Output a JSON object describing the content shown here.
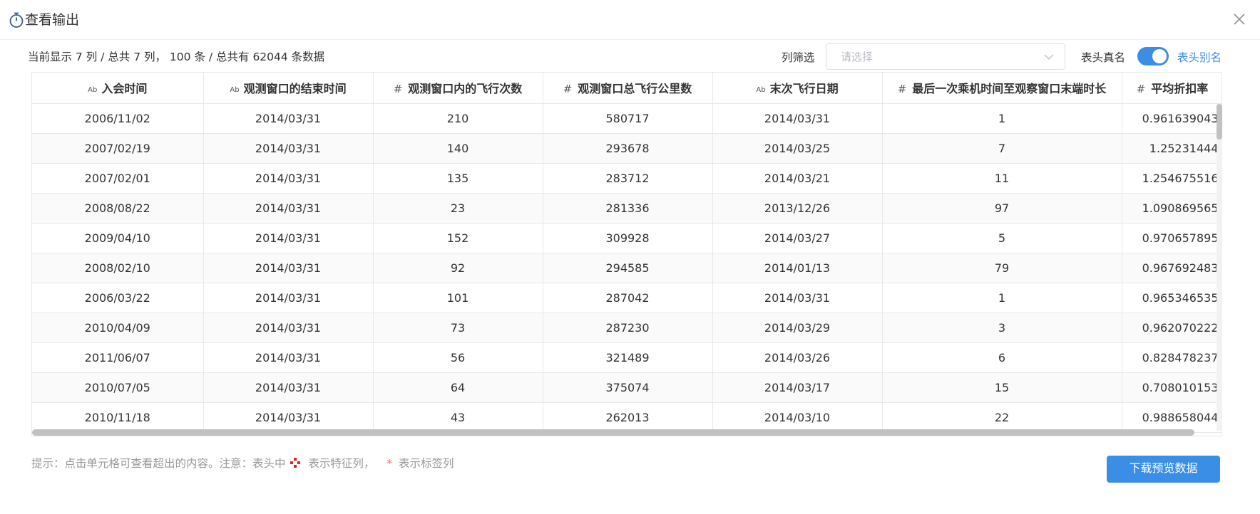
{
  "dialog": {
    "title": "查看输出",
    "icon": "stopwatch-icon",
    "close_icon": "close-icon"
  },
  "toolbar": {
    "info": "当前显示 7 列 / 总共 7 列， 100 条 / 总共有 62044 条数据",
    "filter_label": "列筛选",
    "filter_placeholder": "请选择",
    "realname_label": "表头真名",
    "toggle_on": true,
    "alias_label": "表头别名"
  },
  "table": {
    "columns": [
      {
        "type": "Ab",
        "label": "入会时间"
      },
      {
        "type": "Ab",
        "label": "观测窗口的结束时间"
      },
      {
        "type": "#",
        "label": "观测窗口内的飞行次数"
      },
      {
        "type": "#",
        "label": "观测窗口总飞行公里数"
      },
      {
        "type": "Ab",
        "label": "末次飞行日期"
      },
      {
        "type": "#",
        "label": "最后一次乘机时间至观察窗口末端时长"
      },
      {
        "type": "#",
        "label": "平均折扣率"
      }
    ],
    "rows": [
      [
        "2006/11/02",
        "2014/03/31",
        "210",
        "580717",
        "2014/03/31",
        "1",
        "0.961639043"
      ],
      [
        "2007/02/19",
        "2014/03/31",
        "140",
        "293678",
        "2014/03/25",
        "7",
        "1.25231444"
      ],
      [
        "2007/02/01",
        "2014/03/31",
        "135",
        "283712",
        "2014/03/21",
        "11",
        "1.254675516"
      ],
      [
        "2008/08/22",
        "2014/03/31",
        "23",
        "281336",
        "2013/12/26",
        "97",
        "1.090869565"
      ],
      [
        "2009/04/10",
        "2014/03/31",
        "152",
        "309928",
        "2014/03/27",
        "5",
        "0.970657895"
      ],
      [
        "2008/02/10",
        "2014/03/31",
        "92",
        "294585",
        "2014/01/13",
        "79",
        "0.967692483"
      ],
      [
        "2006/03/22",
        "2014/03/31",
        "101",
        "287042",
        "2014/03/31",
        "1",
        "0.965346535"
      ],
      [
        "2010/04/09",
        "2014/03/31",
        "73",
        "287230",
        "2014/03/29",
        "3",
        "0.962070222"
      ],
      [
        "2011/06/07",
        "2014/03/31",
        "56",
        "321489",
        "2014/03/26",
        "6",
        "0.828478237"
      ],
      [
        "2010/07/05",
        "2014/03/31",
        "64",
        "375074",
        "2014/03/17",
        "15",
        "0.708010153"
      ],
      [
        "2010/11/18",
        "2014/03/31",
        "43",
        "262013",
        "2014/03/10",
        "22",
        "0.988658044"
      ]
    ]
  },
  "footer": {
    "hint_prefix": "提示：点击单元格可查看超出的内容。注意：表头中",
    "hint_feature": "表示特征列，",
    "hint_star": "*",
    "hint_label": "表示标签列",
    "feature_icon": "feature-column-icon",
    "download_label": "下载预览数据"
  },
  "colors": {
    "accent": "#3a8ee6",
    "label_star": "#f56c6c",
    "feature_icon": "#e02020"
  }
}
